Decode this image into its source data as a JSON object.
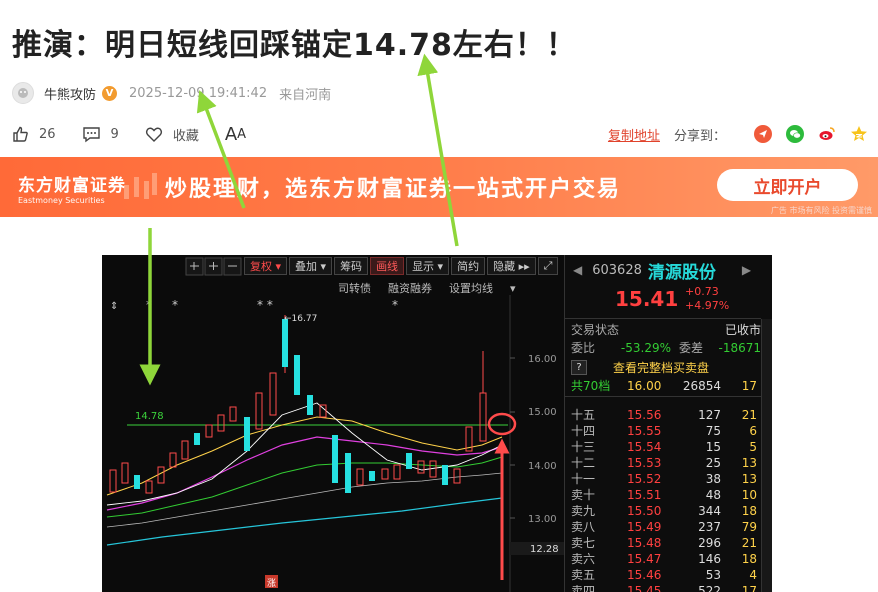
{
  "article": {
    "title": "推演：明日短线回踩锚定14.78左右！！",
    "author": "牛熊攻防",
    "verified_badge": "V",
    "timestamp": "2025-12-09 19:41:42",
    "location": "来自河南"
  },
  "actions": {
    "likes": "26",
    "comments": "9",
    "favorite_label": "收藏",
    "font_label_big": "A",
    "font_label_small": "A",
    "copy_link": "复制地址",
    "share_to": "分享到："
  },
  "banner": {
    "logo_cn": "东方财富证券",
    "logo_en": "Eastmoney Securities",
    "slogan": "炒股理财，选东方财富证券一站式开户交易",
    "button": "立即开户",
    "ad_note": "广告 市场有风险 投资需谨慎"
  },
  "screenshot": {
    "toolbar": [
      "复权",
      "叠加",
      "筹码",
      "画线",
      "显示",
      "简约",
      "隐藏"
    ],
    "subbar": [
      "司转债",
      "融资融券",
      "设置均线"
    ],
    "peak_label": "←16.77",
    "support_label": "14.78",
    "y_ticks": [
      "16.00",
      "15.00",
      "14.00",
      "13.00",
      "12.28"
    ],
    "limit_up_marker": "涨",
    "quote": {
      "code": "603628",
      "name": "清源股份",
      "price": "15.41",
      "change": "+0.73",
      "change_pct": "+4.97%",
      "status_label": "交易状态",
      "status_value": "已收市",
      "weibi_label": "委比",
      "weibi_value": "-53.29%",
      "weicha_label": "委差",
      "weicha_value": "-18671",
      "full_book": "查看完整档买卖盘",
      "total_label": "共70档",
      "total_price": "16.00",
      "total_vol": "26854",
      "total_diff": "17",
      "orderbook": [
        {
          "label": "十五",
          "price": "15.56",
          "vol": "127",
          "diff": "21"
        },
        {
          "label": "十四",
          "price": "15.55",
          "vol": "75",
          "diff": "6"
        },
        {
          "label": "十三",
          "price": "15.54",
          "vol": "15",
          "diff": "5"
        },
        {
          "label": "十二",
          "price": "15.53",
          "vol": "25",
          "diff": "13"
        },
        {
          "label": "十一",
          "price": "15.52",
          "vol": "38",
          "diff": "13"
        },
        {
          "label": "卖十",
          "price": "15.51",
          "vol": "48",
          "diff": "10"
        },
        {
          "label": "卖九",
          "price": "15.50",
          "vol": "344",
          "diff": "18"
        },
        {
          "label": "卖八",
          "price": "15.49",
          "vol": "237",
          "diff": "79"
        },
        {
          "label": "卖七",
          "price": "15.48",
          "vol": "296",
          "diff": "21"
        },
        {
          "label": "卖六",
          "price": "15.47",
          "vol": "146",
          "diff": "18"
        },
        {
          "label": "卖五",
          "price": "15.46",
          "vol": "53",
          "diff": "4"
        },
        {
          "label": "卖四",
          "price": "15.45",
          "vol": "522",
          "diff": "17"
        }
      ]
    }
  }
}
